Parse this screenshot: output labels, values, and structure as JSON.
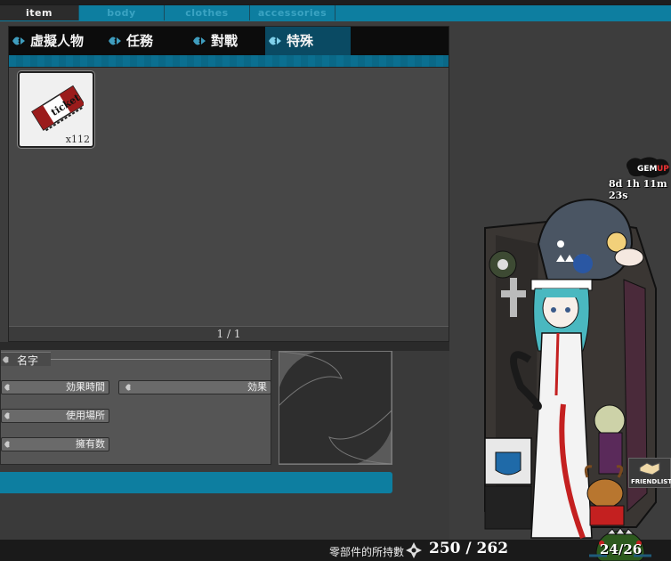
{
  "top_tabs": [
    {
      "label": "item",
      "active": true
    },
    {
      "label": "body",
      "active": false
    },
    {
      "label": "clothes",
      "active": false
    },
    {
      "label": "accessories",
      "active": false
    }
  ],
  "categories": [
    {
      "label": "虛擬人物",
      "active": false
    },
    {
      "label": "任務",
      "active": false
    },
    {
      "label": "對戰",
      "active": false
    },
    {
      "label": "特殊",
      "active": true
    }
  ],
  "items": [
    {
      "name": "ticket",
      "icon": "ticket-icon",
      "quantity": "x112"
    }
  ],
  "pager": {
    "text": "1 / 1"
  },
  "detail": {
    "name_label": "名字",
    "duration_label": "効果時間",
    "effect_label": "効果",
    "location_label": "使用場所",
    "owned_label": "擁有数"
  },
  "parts": {
    "label": "零部件的所持數",
    "count": "250 / 262"
  },
  "gem": {
    "label": "GEM",
    "suffix": "UP",
    "stats": "8d 1h 11m 23s"
  },
  "friend_list": {
    "label": "FRIENDLIST"
  },
  "level": {
    "text": "24/26"
  },
  "colors": {
    "accent": "#0d7ea0",
    "active_tab": "#0a4a63",
    "panel_bg": "#474747"
  }
}
